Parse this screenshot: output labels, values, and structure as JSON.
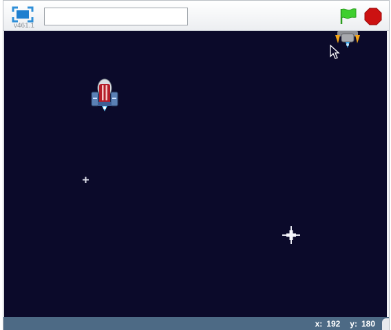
{
  "app": {
    "version": "v461.1"
  },
  "toolbar": {
    "fullscreen_icon": "fullscreen-icon",
    "project_title_value": "",
    "flag_icon": "green-flag-icon",
    "stop_icon": "stop-icon",
    "flag_color": "#3fcf2e",
    "stop_color": "#cc1111"
  },
  "stage": {
    "background_color": "#0b0a2a",
    "sprites": [
      "player-ship",
      "enemy-ship",
      "star",
      "star"
    ]
  },
  "status": {
    "x_label": "x:",
    "x_value": "192",
    "y_label": "y:",
    "y_value": "180"
  }
}
